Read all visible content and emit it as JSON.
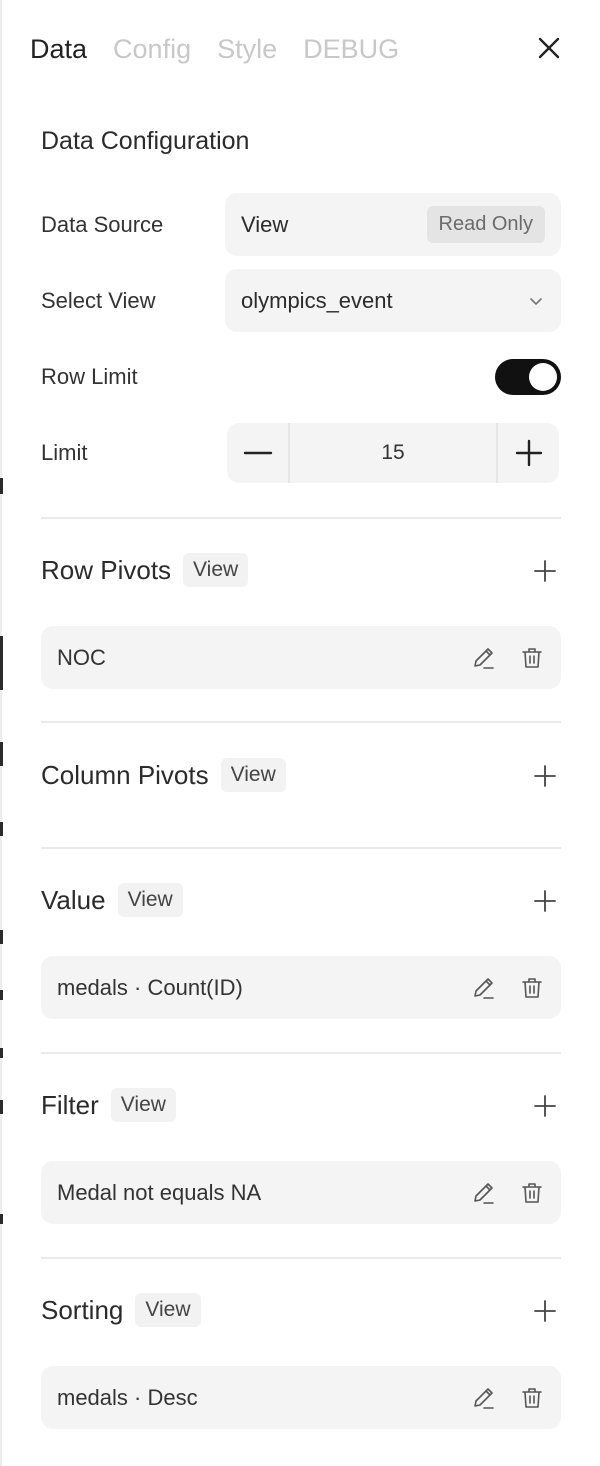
{
  "tabs": [
    "Data",
    "Config",
    "Style",
    "DEBUG"
  ],
  "section_title": "Data Configuration",
  "form": {
    "data_source_label": "Data Source",
    "data_source_value": "View",
    "data_source_badge": "Read Only",
    "select_view_label": "Select View",
    "select_view_value": "olympics_event",
    "row_limit_label": "Row Limit",
    "row_limit_enabled": true,
    "limit_label": "Limit",
    "limit_value": "15"
  },
  "groups": {
    "row_pivots": {
      "title": "Row Pivots",
      "badge": "View",
      "items": [
        "NOC"
      ]
    },
    "column_pivots": {
      "title": "Column Pivots",
      "badge": "View",
      "items": []
    },
    "value": {
      "title": "Value",
      "badge": "View",
      "items": [
        "medals · Count(ID)"
      ]
    },
    "filter": {
      "title": "Filter",
      "badge": "View",
      "items": [
        "Medal not equals NA"
      ]
    },
    "sorting": {
      "title": "Sorting",
      "badge": "View",
      "items": [
        "medals · Desc"
      ]
    }
  },
  "icons": {
    "close": "close-icon",
    "chevron": "chevron-down-icon",
    "minus": "minus-icon",
    "plus": "plus-icon",
    "edit": "edit-icon",
    "delete": "trash-icon"
  },
  "colors": {
    "toggle_on": "#111111",
    "field_bg": "#f4f4f4",
    "inactive_tab": "#c8c8c8"
  }
}
